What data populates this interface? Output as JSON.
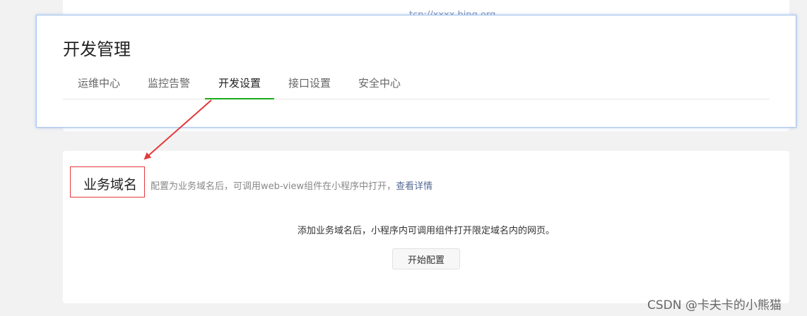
{
  "background": {
    "partial_url": "tcp://xxxx.bing.org"
  },
  "panel": {
    "title": "开发管理",
    "tabs": [
      {
        "label": "运维中心",
        "active": false
      },
      {
        "label": "监控告警",
        "active": false
      },
      {
        "label": "开发设置",
        "active": true
      },
      {
        "label": "接口设置",
        "active": false
      },
      {
        "label": "安全中心",
        "active": false
      }
    ]
  },
  "section": {
    "title": "业务域名",
    "description": "配置为业务域名后，可调用web-view组件在小程序中打开，",
    "link": "查看详情",
    "empty_tip": "添加业务域名后，小程序内可调用组件打开限定域名内的网页。",
    "start_button": "开始配置"
  },
  "watermark": "CSDN @卡夫卡的小熊猫",
  "colors": {
    "active_tab_underline": "#1aad19",
    "annotation_red": "#e5383b",
    "link": "#576b95",
    "panel_border": "#a9c6ee"
  }
}
